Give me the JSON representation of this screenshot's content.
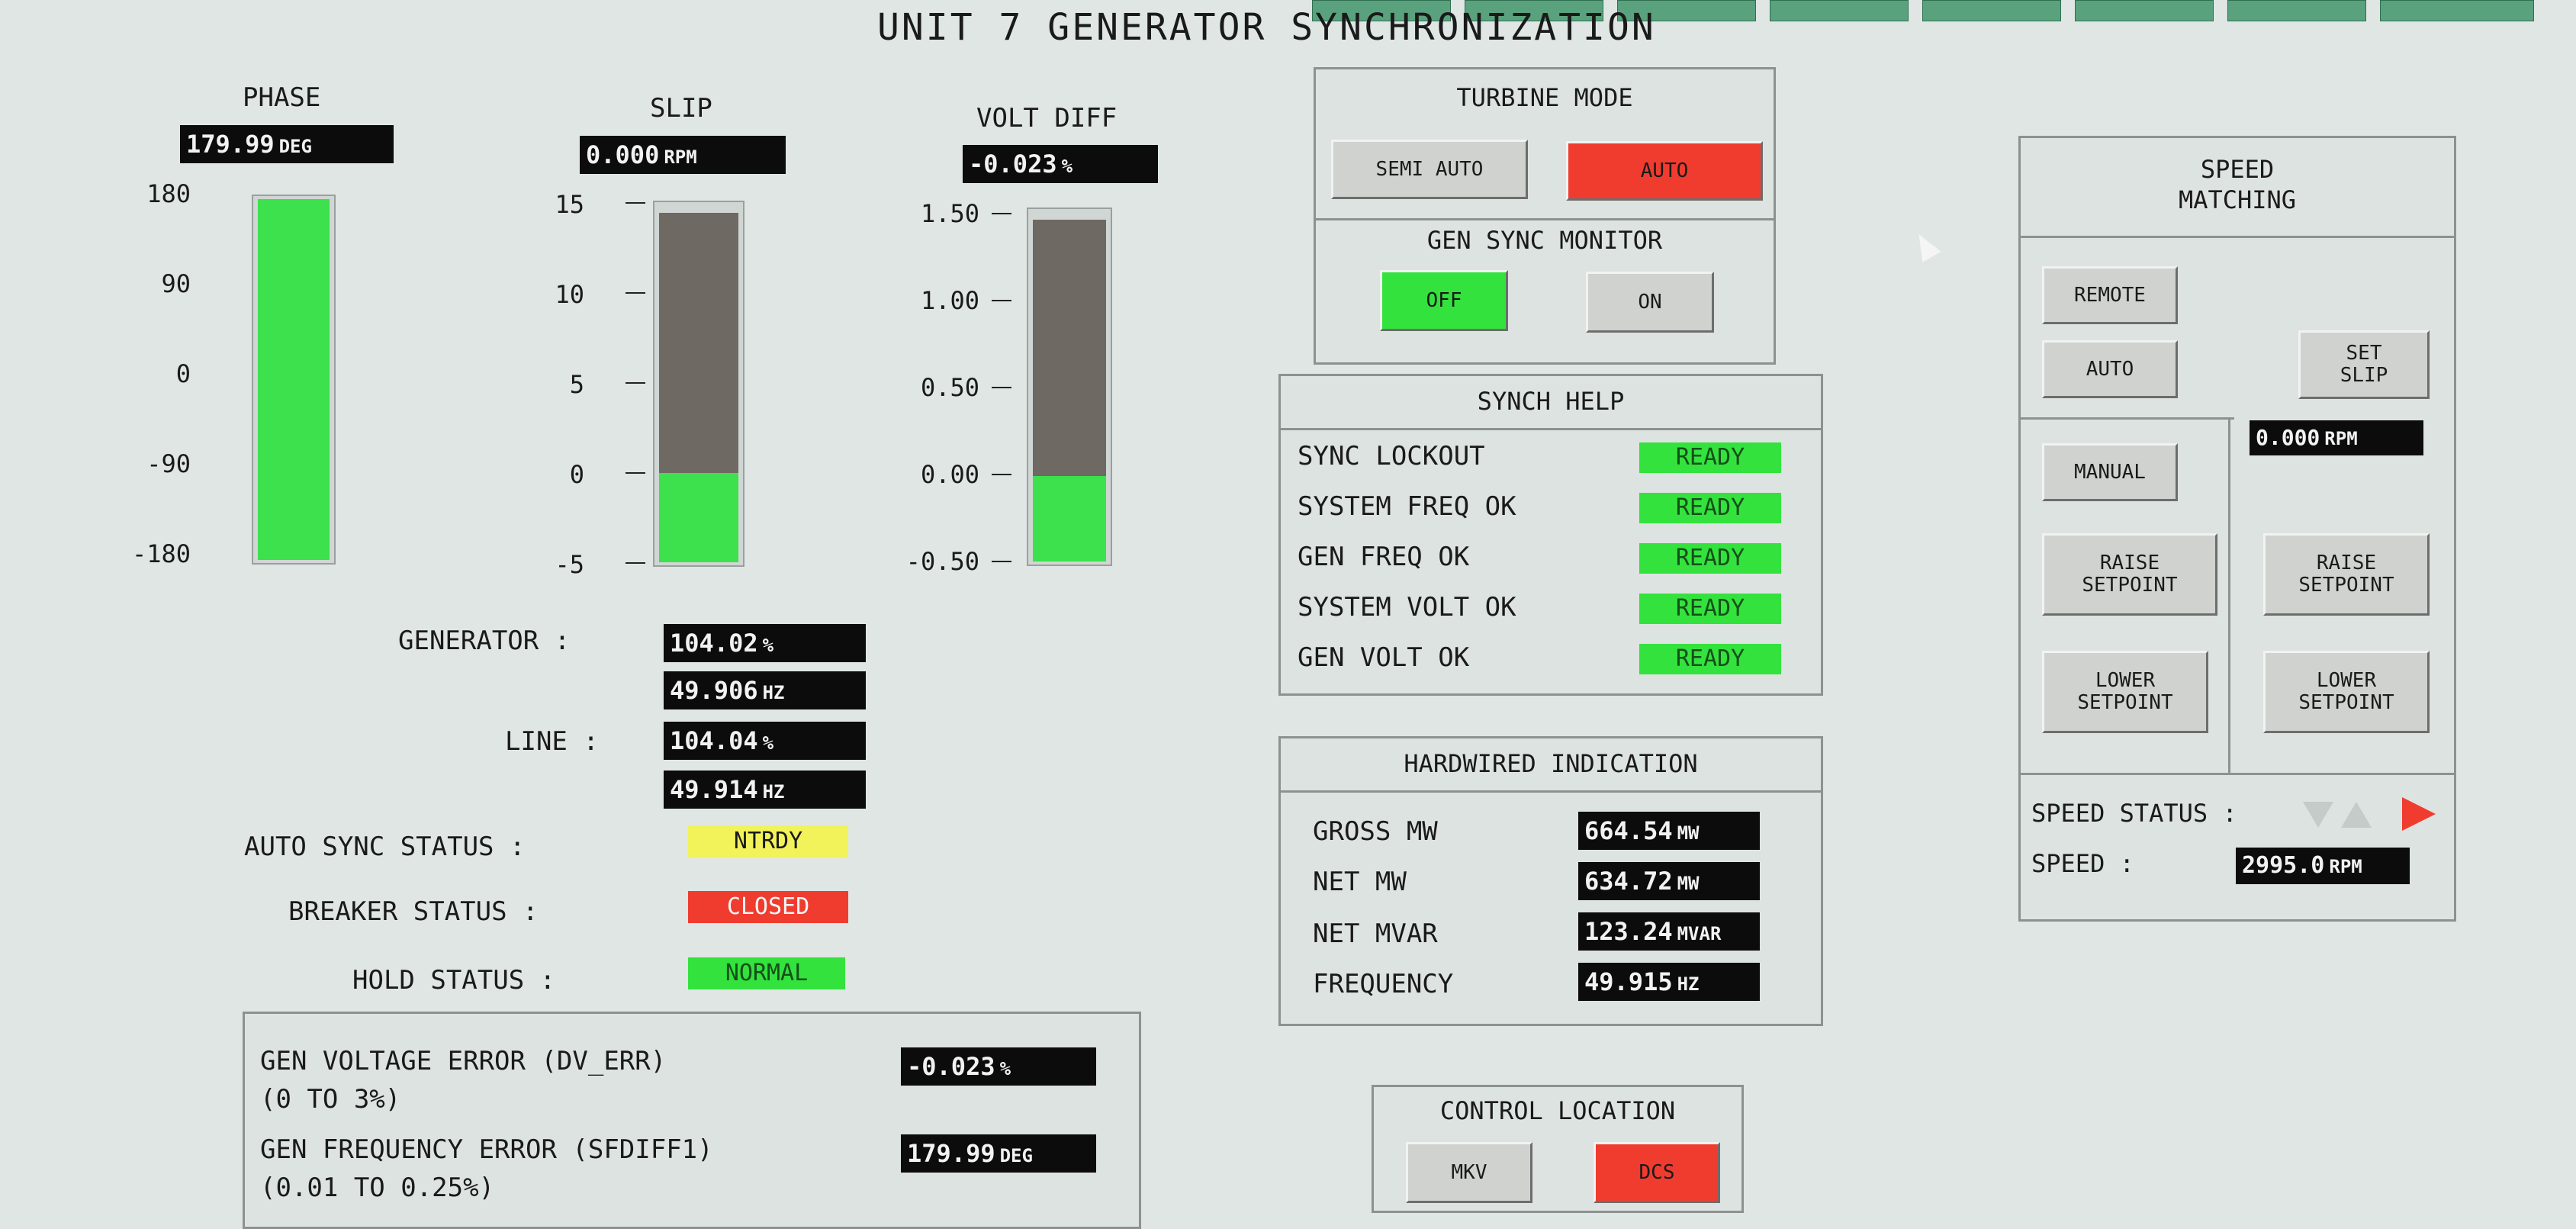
{
  "title": "UNIT 7 GENERATOR SYNCHRONIZATION",
  "gauges": {
    "phase": {
      "label": "PHASE",
      "value": "179.99",
      "unit": "DEG",
      "scale": [
        "180",
        "90",
        "0",
        "-90",
        "-180"
      ],
      "level_fraction": 1.0
    },
    "slip": {
      "label": "SLIP",
      "value": "0.000",
      "unit": "RPM",
      "scale": [
        "15",
        "10",
        "5",
        "0",
        "-5"
      ],
      "level_fraction": 0.25
    },
    "voltdiff": {
      "label": "VOLT DIFF",
      "value": "-0.023",
      "unit": "%",
      "scale": [
        "1.50",
        "1.00",
        "0.50",
        "0.00",
        "-0.50"
      ],
      "level_fraction": 0.245
    }
  },
  "readings": {
    "generator_label": "GENERATOR  :",
    "generator_pct": "104.02",
    "generator_pct_unit": "%",
    "generator_hz": "49.906",
    "generator_hz_unit": "HZ",
    "line_label": "LINE  :",
    "line_pct": "104.04",
    "line_pct_unit": "%",
    "line_hz": "49.914",
    "line_hz_unit": "HZ"
  },
  "status": {
    "auto_sync_label": "AUTO SYNC STATUS  :",
    "auto_sync_value": "NTRDY",
    "auto_sync_color": "#f2f25a",
    "breaker_label": "BREAKER STATUS  :",
    "breaker_value": "CLOSED",
    "breaker_color": "#ef3c2f",
    "hold_label": "HOLD STATUS  :",
    "hold_value": "NORMAL",
    "hold_color": "#33e23d"
  },
  "errors": {
    "dv_label": "GEN VOLTAGE ERROR (DV_ERR)",
    "dv_range": "(0 TO 3%)",
    "dv_value": "-0.023",
    "dv_unit": "%",
    "sf_label": "GEN FREQUENCY ERROR (SFDIFF1)",
    "sf_range": "(0.01 TO 0.25%)",
    "sf_value": "179.99",
    "sf_unit": "DEG"
  },
  "turbine_mode": {
    "title": "TURBINE MODE",
    "semi_auto": "SEMI AUTO",
    "auto": "AUTO"
  },
  "gen_sync_monitor": {
    "title": "GEN SYNC MONITOR",
    "off": "OFF",
    "on": "ON"
  },
  "synch_help": {
    "title": "SYNCH HELP",
    "items": [
      {
        "label": "SYNC LOCKOUT",
        "value": "READY"
      },
      {
        "label": "SYSTEM FREQ OK",
        "value": "READY"
      },
      {
        "label": "GEN FREQ OK",
        "value": "READY"
      },
      {
        "label": "SYSTEM VOLT OK",
        "value": "READY"
      },
      {
        "label": "GEN VOLT OK",
        "value": "READY"
      }
    ]
  },
  "hardwired": {
    "title": "HARDWIRED INDICATION",
    "items": [
      {
        "label": "GROSS MW",
        "value": "664.54",
        "unit": "MW"
      },
      {
        "label": "NET MW",
        "value": "634.72",
        "unit": "MW"
      },
      {
        "label": "NET MVAR",
        "value": "123.24",
        "unit": "MVAR"
      },
      {
        "label": "FREQUENCY",
        "value": "49.915",
        "unit": "HZ"
      }
    ]
  },
  "control_location": {
    "title": "CONTROL LOCATION",
    "mkv": "MKV",
    "dcs": "DCS"
  },
  "speed_matching": {
    "title_line1": "SPEED",
    "title_line2": "MATCHING",
    "remote": "REMOTE",
    "auto": "AUTO",
    "manual": "MANUAL",
    "set_slip_line1": "SET",
    "set_slip_line2": "SLIP",
    "slip_value": "0.000",
    "slip_unit": "RPM",
    "raise_l1": "RAISE",
    "raise_l2": "SETPOINT",
    "lower_l1": "LOWER",
    "lower_l2": "SETPOINT",
    "speed_status_label": "SPEED STATUS  :",
    "speed_label": "SPEED  :",
    "speed_value": "2995.0",
    "speed_unit": "RPM"
  },
  "colors": {
    "green": "#33e23d",
    "red": "#ef3c2f",
    "yellow": "#f2f25a",
    "bar_gray": "#6f6963",
    "background": "#dfe6e3"
  }
}
